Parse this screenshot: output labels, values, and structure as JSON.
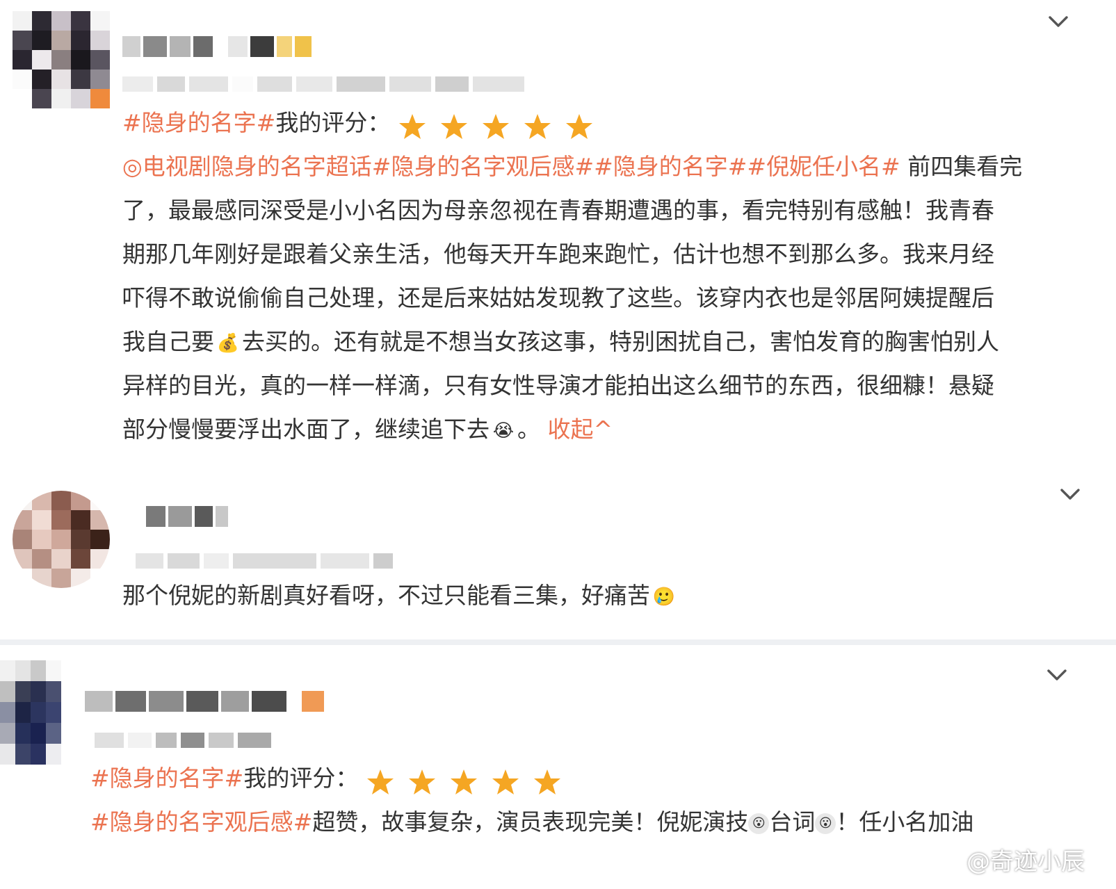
{
  "comments": [
    {
      "hashtag": "#隐身的名字#",
      "rating_label": "我的评分：",
      "stars": 5,
      "body_topics": "◎电视剧隐身的名字超话#隐身的名字观后感##隐身的名字##倪妮任小名#",
      "body_line1_text": " 前四集看完",
      "body_line2": "了，最最感同深受是小小名因为母亲忽视在青春期遭遇的事，看完特别有感触！我青春",
      "body_line3": "期那几年刚好是跟着父亲生活，他每天开车跑来跑忙，估计也想不到那么多。我来月经",
      "body_line4": "吓得不敢说偷偷自己处理，还是后来姑姑发现教了这些。该穿内衣也是邻居阿姨提醒后",
      "body_line5a": "我自己要",
      "body_line5b": "去买的。还有就是不想当女孩这事，特别困扰自己，害怕发育的胸害怕别人",
      "body_line6": "异样的目光，真的一样一样滴，只有女性导演才能拍出这么细节的东西，很细糠！悬疑",
      "body_line7": "部分慢慢要浮出水面了，继续追下去",
      "body_line7_end": "。",
      "collapse_label": "收起^",
      "emoji_money": "💰",
      "emoji_cry": "😭"
    },
    {
      "body": "那个倪妮的新剧真好看呀，不过只能看三集，好痛苦",
      "emoji": "🥲"
    },
    {
      "hashtag": "#隐身的名字#",
      "rating_label": "我的评分：",
      "stars": 5,
      "body_hashtag": "#隐身的名字观后感#",
      "body_text": "超赞，故事复杂，演员表现完美！倪妮演技",
      "body_text2": "台词",
      "body_text3": "！任小名加油"
    }
  ],
  "watermark": "@奇迹小辰",
  "colors": {
    "accent": "#eb7350",
    "star": "#f5a623",
    "text": "#333333"
  },
  "icons": {
    "expand": "chevron-down-icon",
    "star": "star-icon",
    "watermark": "weibo-logo-icon"
  }
}
